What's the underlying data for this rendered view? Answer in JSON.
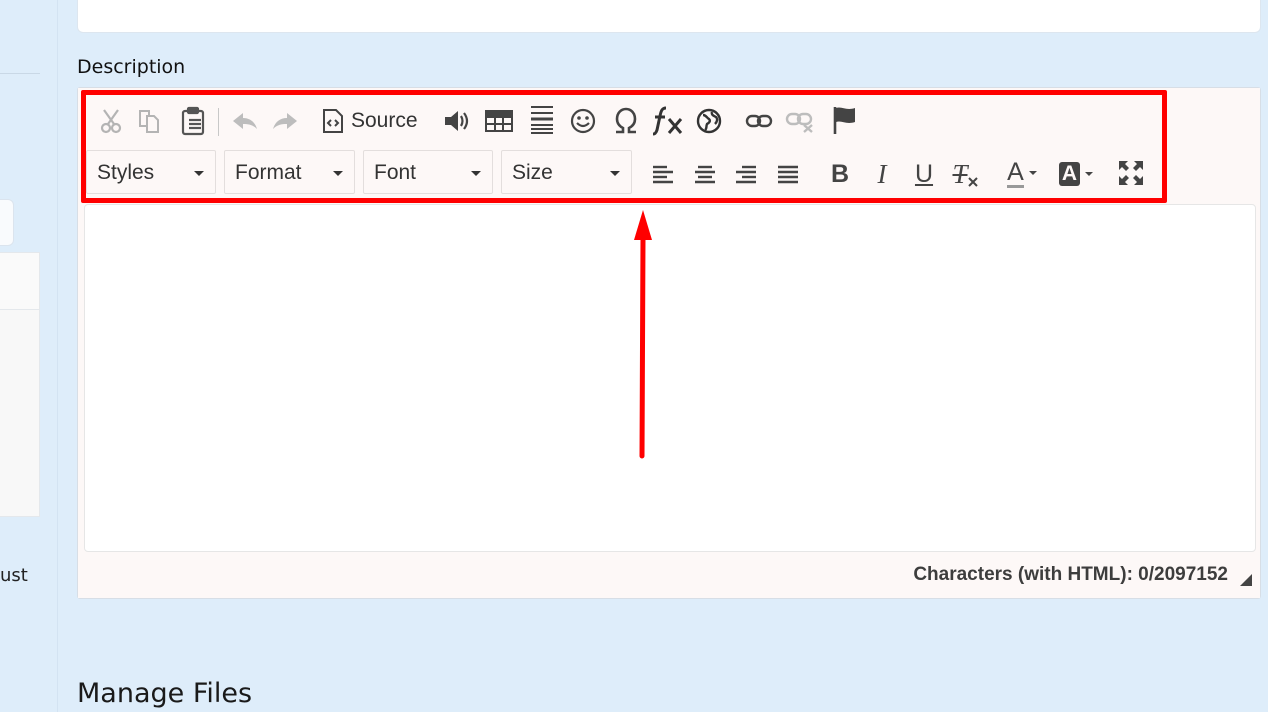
{
  "sidebar": {
    "partial_text": "ust"
  },
  "description": {
    "label": "Description"
  },
  "toolbar": {
    "source_label": "Source",
    "combos": {
      "styles": "Styles",
      "format": "Format",
      "font": "Font",
      "size": "Size"
    },
    "icons": [
      "cut-icon",
      "copy-icon",
      "paste-icon",
      "undo-icon",
      "redo-icon",
      "source-icon",
      "audio-icon",
      "table-icon",
      "horizontal-rule-icon",
      "smiley-icon",
      "special-character-icon",
      "math-formula-icon",
      "iframe-globe-icon",
      "link-icon",
      "unlink-icon",
      "anchor-flag-icon",
      "align-left-icon",
      "align-center-icon",
      "align-right-icon",
      "justify-icon",
      "bold-icon",
      "italic-icon",
      "underline-icon",
      "remove-format-icon",
      "text-color-icon",
      "background-color-icon",
      "maximize-icon"
    ],
    "letters": {
      "bold": "B",
      "italic": "I",
      "underline": "U",
      "remove_format": "T",
      "text_color": "A",
      "bg_color": "A"
    }
  },
  "editor": {
    "content": ""
  },
  "statusbar": {
    "char_count": "Characters (with HTML): 0/2097152"
  },
  "section": {
    "title": "Manage Files"
  },
  "colors": {
    "annotation": "#ff0000",
    "page_bg": "#deedfa",
    "toolbar_bg": "#fdf8f7"
  }
}
